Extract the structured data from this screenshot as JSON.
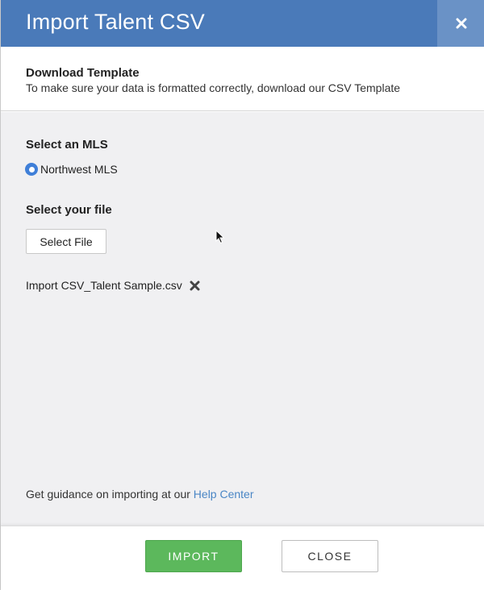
{
  "dialog": {
    "title": "Import Talent CSV",
    "close_icon": "close-icon"
  },
  "template": {
    "title": "Download Template",
    "description": "To make sure your data is formatted correctly, download our CSV Template"
  },
  "mls": {
    "label": "Select an MLS",
    "options": [
      {
        "label": "Northwest MLS",
        "selected": true
      }
    ]
  },
  "file": {
    "label": "Select your file",
    "button_label": "Select File",
    "selected_name": "Import CSV_Talent Sample.csv",
    "remove_icon": "remove-file-icon"
  },
  "guidance": {
    "text": "Get guidance on importing at our ",
    "link": "Help Center"
  },
  "footer": {
    "import_label": "IMPORT",
    "close_label": "CLOSE"
  },
  "colors": {
    "header": "#4a7ab9",
    "header_close": "#6a92c6",
    "import": "#5cb85c",
    "link": "#4a86c5",
    "radio": "#3f7fd8"
  }
}
